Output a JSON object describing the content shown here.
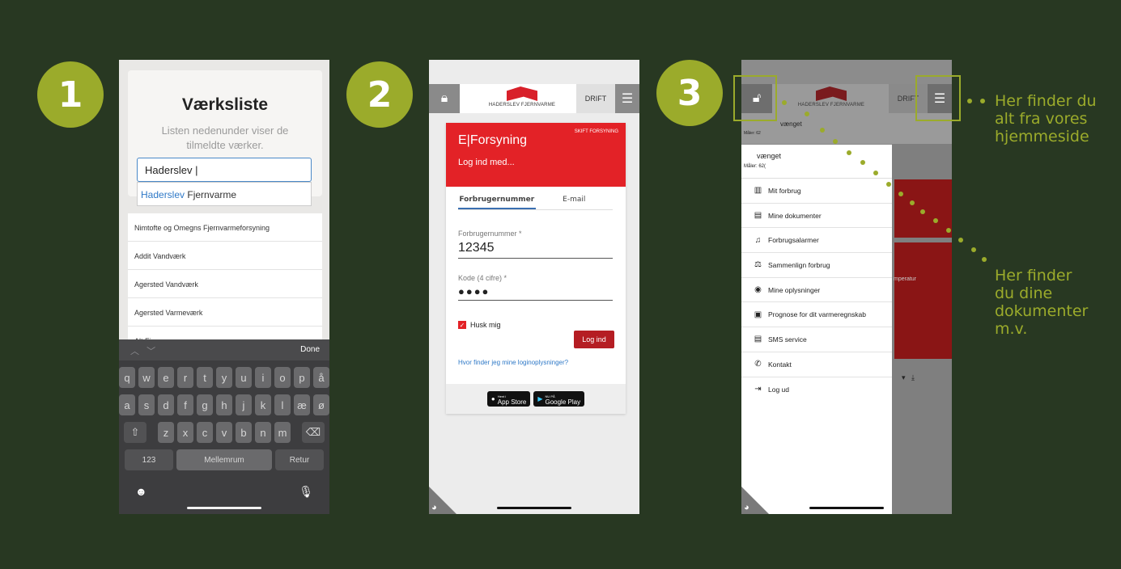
{
  "steps": [
    "1",
    "2",
    "3"
  ],
  "phone1": {
    "title": "Værksliste",
    "subtitle": "Listen nedenunder viser de tilmeldte værker.",
    "search_value": "Haderslev |",
    "suggestion_highlight": "Haderslev",
    "suggestion_rest": " Fjernvarme",
    "list": [
      "Nimtofte og Omegns Fjernvarmeforsyning",
      "Addit Vandværk",
      "Agersted Vandværk",
      "Agersted Varmeværk",
      "Alt Fjernvarme"
    ],
    "keyboard": {
      "done": "Done",
      "row1": [
        "q",
        "w",
        "e",
        "r",
        "t",
        "y",
        "u",
        "i",
        "o",
        "p",
        "å"
      ],
      "row2": [
        "a",
        "s",
        "d",
        "f",
        "g",
        "h",
        "j",
        "k",
        "l",
        "æ",
        "ø"
      ],
      "row3": [
        "z",
        "x",
        "c",
        "v",
        "b",
        "n",
        "m"
      ],
      "num": "123",
      "space": "Mellemrum",
      "return": "Retur"
    }
  },
  "header": {
    "logo_text": "HADERSLEV FJERNVARME",
    "drift": "DRIFT"
  },
  "phone2": {
    "skift": "SKIFT FORSYNING",
    "brand": "E|Forsyning",
    "login_with": "Log ind med...",
    "tab_consumer": "Forbrugernummer",
    "tab_email": "E-mail",
    "field1_label": "Forbrugernummer *",
    "field1_value": "12345",
    "field2_label": "Kode (4 cifre) *",
    "field2_value": "●●●●",
    "remember": "Husk mig",
    "login_button": "Log ind",
    "help_link": "Hvor finder jeg mine loginoplysninger?",
    "app_store_small": "Hent i",
    "app_store": "App Store",
    "google_play_small": "NU PÅ",
    "google_play": "Google Play"
  },
  "phone3": {
    "account_name": "vænget",
    "meter_short": "Måler: 62",
    "meter": "Måler: 62(",
    "menu": [
      {
        "icon": "bar-chart-icon",
        "glyph": "▥",
        "label": "Mit forbrug"
      },
      {
        "icon": "document-icon",
        "glyph": "▤",
        "label": "Mine dokumenter"
      },
      {
        "icon": "bell-icon",
        "glyph": "♫",
        "label": "Forbrugsalarmer"
      },
      {
        "icon": "scale-icon",
        "glyph": "⚖",
        "label": "Sammenlign forbrug"
      },
      {
        "icon": "user-circle-icon",
        "glyph": "◉",
        "label": "Mine oplysninger"
      },
      {
        "icon": "forecast-icon",
        "glyph": "▣",
        "label": "Prognose for dit varmeregnskab"
      },
      {
        "icon": "message-icon",
        "glyph": "▤",
        "label": "SMS service"
      },
      {
        "icon": "phone-icon",
        "glyph": "✆",
        "label": "Kontakt"
      },
      {
        "icon": "logout-icon",
        "glyph": "⇥",
        "label": "Log ud"
      }
    ],
    "bg_text": "mperatur"
  },
  "callouts": {
    "top": [
      "Her finder du",
      "alt fra vores",
      "hjemmeside"
    ],
    "bottom": [
      "Her finder",
      "du dine",
      "dokumenter",
      "m.v."
    ]
  },
  "colors": {
    "background": "#283822",
    "accent_green": "#9bab2b",
    "brand_red": "#e32227"
  }
}
